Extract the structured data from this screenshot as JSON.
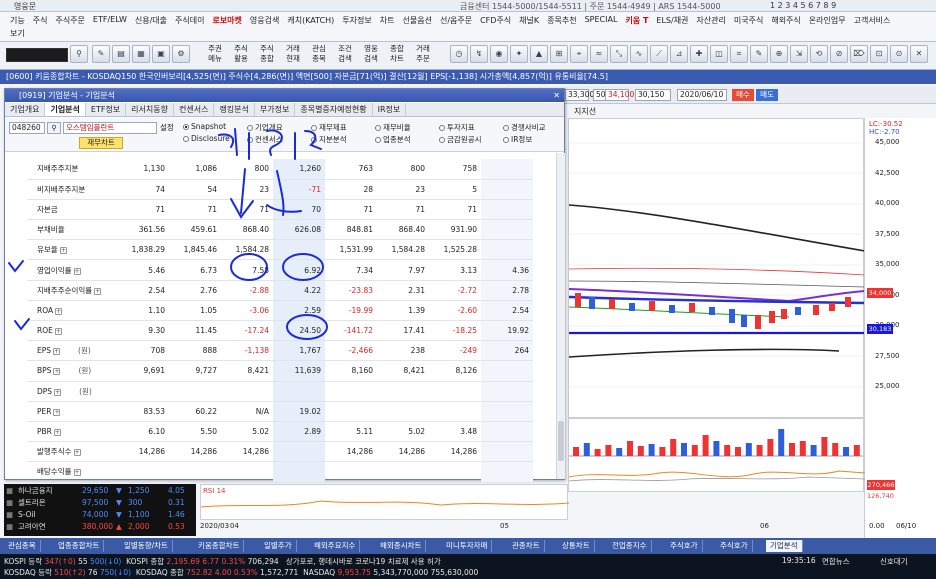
{
  "app_title": "영웅문",
  "phones": "금융센터 1544-5000/1544-5511  |  주문 1544-4949  |  ARS 1544-5000",
  "nav_keys": "1 2 3 4 5 6 7 8 9",
  "menu_row1": [
    "기능",
    "주식",
    "주식주문",
    "ETF/ELW",
    "신용/대출",
    "주식데이",
    "로보마켓",
    "영웅검색",
    "캐치(KATCH)",
    "투자정보",
    "차트",
    "선물옵션",
    "선/옵주문",
    "CFD주식",
    "채널K",
    "종목추천",
    "SPECIAL",
    "키움 T",
    "ELS/채권",
    "자산관리",
    "미국주식",
    "해외주식",
    "온라인업무",
    "고객서비스"
  ],
  "menu_row2": [
    "보기"
  ],
  "toolbar_words": [
    "주권\n메뉴",
    "주식\n활용",
    "주식\n종합",
    "거래\n현재",
    "관심\n종목",
    "조건\n검색",
    "영웅\n검색",
    "종합\n차트",
    "거래\n주문"
  ],
  "chart_window": {
    "title": "[0600] 키움종합차트 - KOSDAQ150 한국인버보리[4,525(면)] 주식수[4,286(면)] 액면[500] 자본금[71(억)] 결산[12월] EPS[-1,138] 시가총액[4,857(억)] 유통비율[74.5]",
    "period_input": "50/600",
    "price_a": "33,300",
    "price_b": "34,100",
    "price_c": "30,150",
    "date_input": "2020/06/10",
    "btn_buy": "매수",
    "btn_sell": "매도",
    "subtitle": "지지선",
    "lc_label": "LC:-30.52",
    "hc_label": "HC:-2.70",
    "y_ticks": [
      "45,000",
      "42,500",
      "40,000",
      "37,500",
      "35,000",
      "32,500",
      "30,000",
      "27,500",
      "25,000"
    ],
    "price_tag": "34,000",
    "support_tag": "30,183",
    "vol_tag": "270,466",
    "vol_sub": "126,740",
    "lower_ticks": [
      "0.00",
      "-50.00"
    ],
    "x_dates": [
      "2020/03",
      "04",
      "05",
      "06",
      "06/10"
    ],
    "rsi_label": "RSI 14"
  },
  "dialog": {
    "title": "[0919] 기업분석 - 기업분석",
    "tabs": [
      "기업개요",
      "기업분석",
      "ETF정보",
      "리서치동향",
      "컨센서스",
      "랭킹분석",
      "부가정보",
      "종목별증자예정현황",
      "IR정보"
    ],
    "active_tab": "기업분석",
    "code": "048260",
    "name": "오스템임플란트",
    "set_label": "설정",
    "financial_btn": "재무차트",
    "radios": [
      "Snapshot",
      "기업개요",
      "재무제표",
      "재무비율",
      "투자지표",
      "경쟁사비교",
      "Disclosure",
      "컨센서스",
      "지분분석",
      "업종분석",
      "금감원공시",
      "IR정보"
    ],
    "rows": [
      {
        "label": "지배주주지분",
        "unit": "",
        "vals": [
          "1,130",
          "1,086",
          "800",
          "1,260",
          "763",
          "800",
          "758",
          ""
        ]
      },
      {
        "label": "비지배주주지분",
        "unit": "",
        "vals": [
          "74",
          "54",
          "23",
          "-71",
          "28",
          "23",
          "5",
          ""
        ]
      },
      {
        "label": "자본금",
        "unit": "",
        "vals": [
          "71",
          "71",
          "71",
          "70",
          "71",
          "71",
          "71",
          ""
        ]
      },
      {
        "label": "부채비율",
        "unit": "",
        "vals": [
          "361.56",
          "459.61",
          "868.40",
          "626.08",
          "848.81",
          "868.40",
          "931.90",
          ""
        ]
      },
      {
        "label": "유보율",
        "unit": "",
        "vals": [
          "1,838.29",
          "1,845.46",
          "1,584.28",
          "",
          "1,531.99",
          "1,584.28",
          "1,525.28",
          ""
        ]
      },
      {
        "label": "영업이익률",
        "unit": "",
        "vals": [
          "5.46",
          "6.73",
          "7.58",
          "6.92",
          "7.34",
          "7.97",
          "3.13",
          "4.36"
        ]
      },
      {
        "label": "지배주주순이익률",
        "unit": "",
        "vals": [
          "2.54",
          "2.76",
          "-2.88",
          "4.22",
          "-23.83",
          "2.31",
          "-2.72",
          "2.78"
        ]
      },
      {
        "label": "ROA",
        "unit": "",
        "vals": [
          "1.10",
          "1.05",
          "-3.06",
          "2.59",
          "-19.99",
          "1.39",
          "-2.60",
          "2.54"
        ]
      },
      {
        "label": "ROE",
        "unit": "",
        "vals": [
          "9.30",
          "11.45",
          "-17.24",
          "24.50",
          "-141.72",
          "17.41",
          "-18.25",
          "19.92"
        ]
      },
      {
        "label": "EPS",
        "unit": "(원)",
        "vals": [
          "708",
          "888",
          "-1,138",
          "1,767",
          "-2,466",
          "238",
          "-249",
          "264"
        ]
      },
      {
        "label": "BPS",
        "unit": "(원)",
        "vals": [
          "9,691",
          "9,727",
          "8,421",
          "11,639",
          "8,160",
          "8,421",
          "8,126",
          ""
        ]
      },
      {
        "label": "DPS",
        "unit": "(원)",
        "vals": [
          "",
          "",
          "",
          "",
          "",
          "",
          "",
          ""
        ]
      },
      {
        "label": "PER",
        "unit": "",
        "vals": [
          "83.53",
          "60.22",
          "N/A",
          "19.02",
          "",
          "",
          "",
          ""
        ]
      },
      {
        "label": "PBR",
        "unit": "",
        "vals": [
          "6.10",
          "5.50",
          "5.02",
          "2.89",
          "5.11",
          "5.02",
          "3.48",
          ""
        ]
      },
      {
        "label": "발행주식수",
        "unit": "",
        "vals": [
          "14,286",
          "14,286",
          "14,286",
          "",
          "14,286",
          "14,286",
          "14,286",
          ""
        ]
      },
      {
        "label": "배당수익률",
        "unit": "",
        "vals": [
          "",
          "",
          "",
          "",
          "",
          "",
          "",
          ""
        ]
      }
    ]
  },
  "tickers": [
    {
      "name": "하나금융지",
      "price": "29,650",
      "chg": "1,250",
      "pct": "4.05",
      "dir": "down"
    },
    {
      "name": "셀트리온",
      "price": "97,500",
      "chg": "300",
      "pct": "0.31",
      "dir": "down"
    },
    {
      "name": "S-Oil",
      "price": "74,000",
      "chg": "1,100",
      "pct": "1.46",
      "dir": "down"
    },
    {
      "name": "고려아연",
      "price": "380,000",
      "chg": "2,000",
      "pct": "0.53",
      "dir": "up"
    }
  ],
  "taskbar": [
    "관심종목",
    "업종종합차트",
    "일별동향/차트",
    "키움종합차트",
    "일별추가",
    "해외주요지수",
    "해외종시차트",
    "미니투자자매",
    "관종차트",
    "상통차트",
    "전업종지수",
    "주식호가",
    "주식호가",
    "기업분석"
  ],
  "active_task": "기업분석",
  "status1": {
    "idx": "KOSPI 등락",
    "up": "347(↑0)",
    "n1": "55",
    "down": "500(↓0)",
    "idx2": "KOSPI 종합",
    "val": "2,195.69",
    "chg": "6.77",
    "pct": "0.31%",
    "vol": "706,294",
    "news": "상가포로, 행데시바로 코로나19 치료제 사용 허가",
    "clock": "19:35:16",
    "feed": "연합뉴스",
    "signal": "신호대기"
  },
  "status2": {
    "left": "KOSDAQ 등락",
    "a": "510(↑2)",
    "b": "76",
    "c": "750(↓0)",
    "d": "KOSDAQ 종합",
    "e": "752.82",
    "f": "4.00",
    "g": "0.53%",
    "h": "1,572,771",
    "i": "NASDAQ",
    "j": "9,953.75",
    "k": "5,343,770,000",
    "l": "755,630,000"
  }
}
